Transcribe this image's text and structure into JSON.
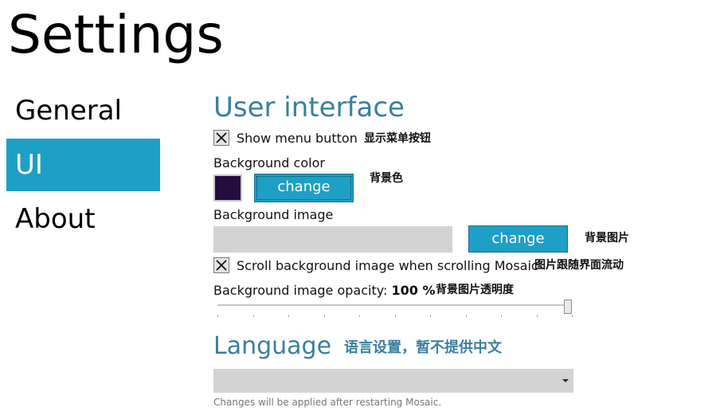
{
  "page": {
    "title": "Settings"
  },
  "nav": {
    "items": [
      {
        "label": "General",
        "active": false
      },
      {
        "label": "UI",
        "active": true
      },
      {
        "label": "About",
        "active": false
      }
    ]
  },
  "ui_section": {
    "title": "User interface",
    "show_menu_button": {
      "label": "Show menu button",
      "checked": true,
      "note": "显示菜单按钮"
    },
    "background_color": {
      "label": "Background color",
      "value": "#240c3e",
      "button_label": "change",
      "note": "背景色"
    },
    "background_image": {
      "label": "Background image",
      "value": "",
      "button_label": "change",
      "note": "背景图片"
    },
    "scroll_background": {
      "label": "Scroll background image when scrolling Mosaic",
      "checked": true,
      "note": "图片跟随界面流动"
    },
    "opacity": {
      "label": "Background image opacity:",
      "value": "100 %",
      "fraction": 1.0,
      "note": "背景图片透明度"
    }
  },
  "language_section": {
    "title": "Language",
    "note": "语言设置，暂不提供中文",
    "selected": "",
    "hint": "Changes will be applied after restarting Mosaic."
  },
  "colors": {
    "accent": "#1e9fc6",
    "section_title": "#3a7fa0"
  }
}
